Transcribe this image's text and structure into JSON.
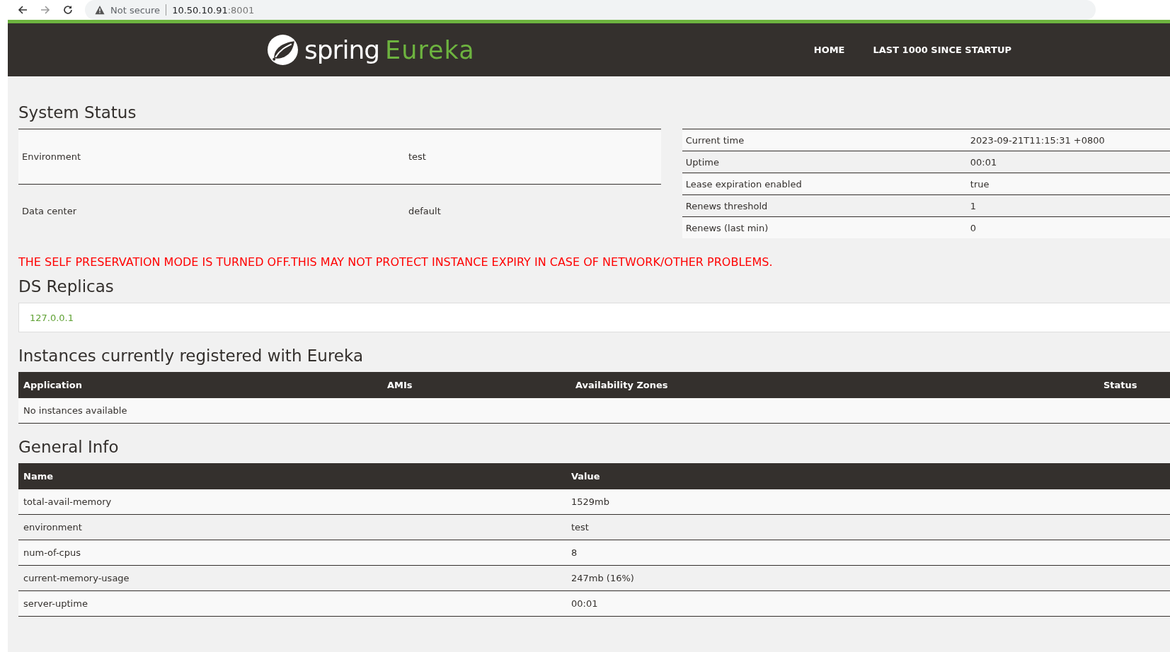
{
  "browser": {
    "security": "Not secure",
    "host": "10.50.10.91",
    "port": ":8001"
  },
  "header": {
    "brand": "spring",
    "product": "Eureka",
    "nav": [
      {
        "label": "HOME"
      },
      {
        "label": "LAST 1000 SINCE STARTUP"
      }
    ]
  },
  "system_status": {
    "title": "System Status",
    "left": [
      {
        "name": "Environment",
        "value": "test"
      },
      {
        "name": "Data center",
        "value": "default"
      }
    ],
    "right": [
      {
        "name": "Current time",
        "value": "2023-09-21T11:15:31 +0800"
      },
      {
        "name": "Uptime",
        "value": "00:01"
      },
      {
        "name": "Lease expiration enabled",
        "value": "true"
      },
      {
        "name": "Renews threshold",
        "value": "1"
      },
      {
        "name": "Renews (last min)",
        "value": "0"
      }
    ]
  },
  "warning": "THE SELF PRESERVATION MODE IS TURNED OFF.THIS MAY NOT PROTECT INSTANCE EXPIRY IN CASE OF NETWORK/OTHER PROBLEMS.",
  "ds_replicas": {
    "title": "DS Replicas",
    "replicas": [
      "127.0.0.1"
    ]
  },
  "instances": {
    "title": "Instances currently registered with Eureka",
    "columns": [
      "Application",
      "AMIs",
      "Availability Zones",
      "Status"
    ],
    "empty": "No instances available"
  },
  "general_info": {
    "title": "General Info",
    "columns": [
      "Name",
      "Value"
    ],
    "rows": [
      {
        "name": "total-avail-memory",
        "value": "1529mb"
      },
      {
        "name": "environment",
        "value": "test"
      },
      {
        "name": "num-of-cpus",
        "value": "8"
      },
      {
        "name": "current-memory-usage",
        "value": "247mb (16%)"
      },
      {
        "name": "server-uptime",
        "value": "00:01"
      }
    ]
  }
}
